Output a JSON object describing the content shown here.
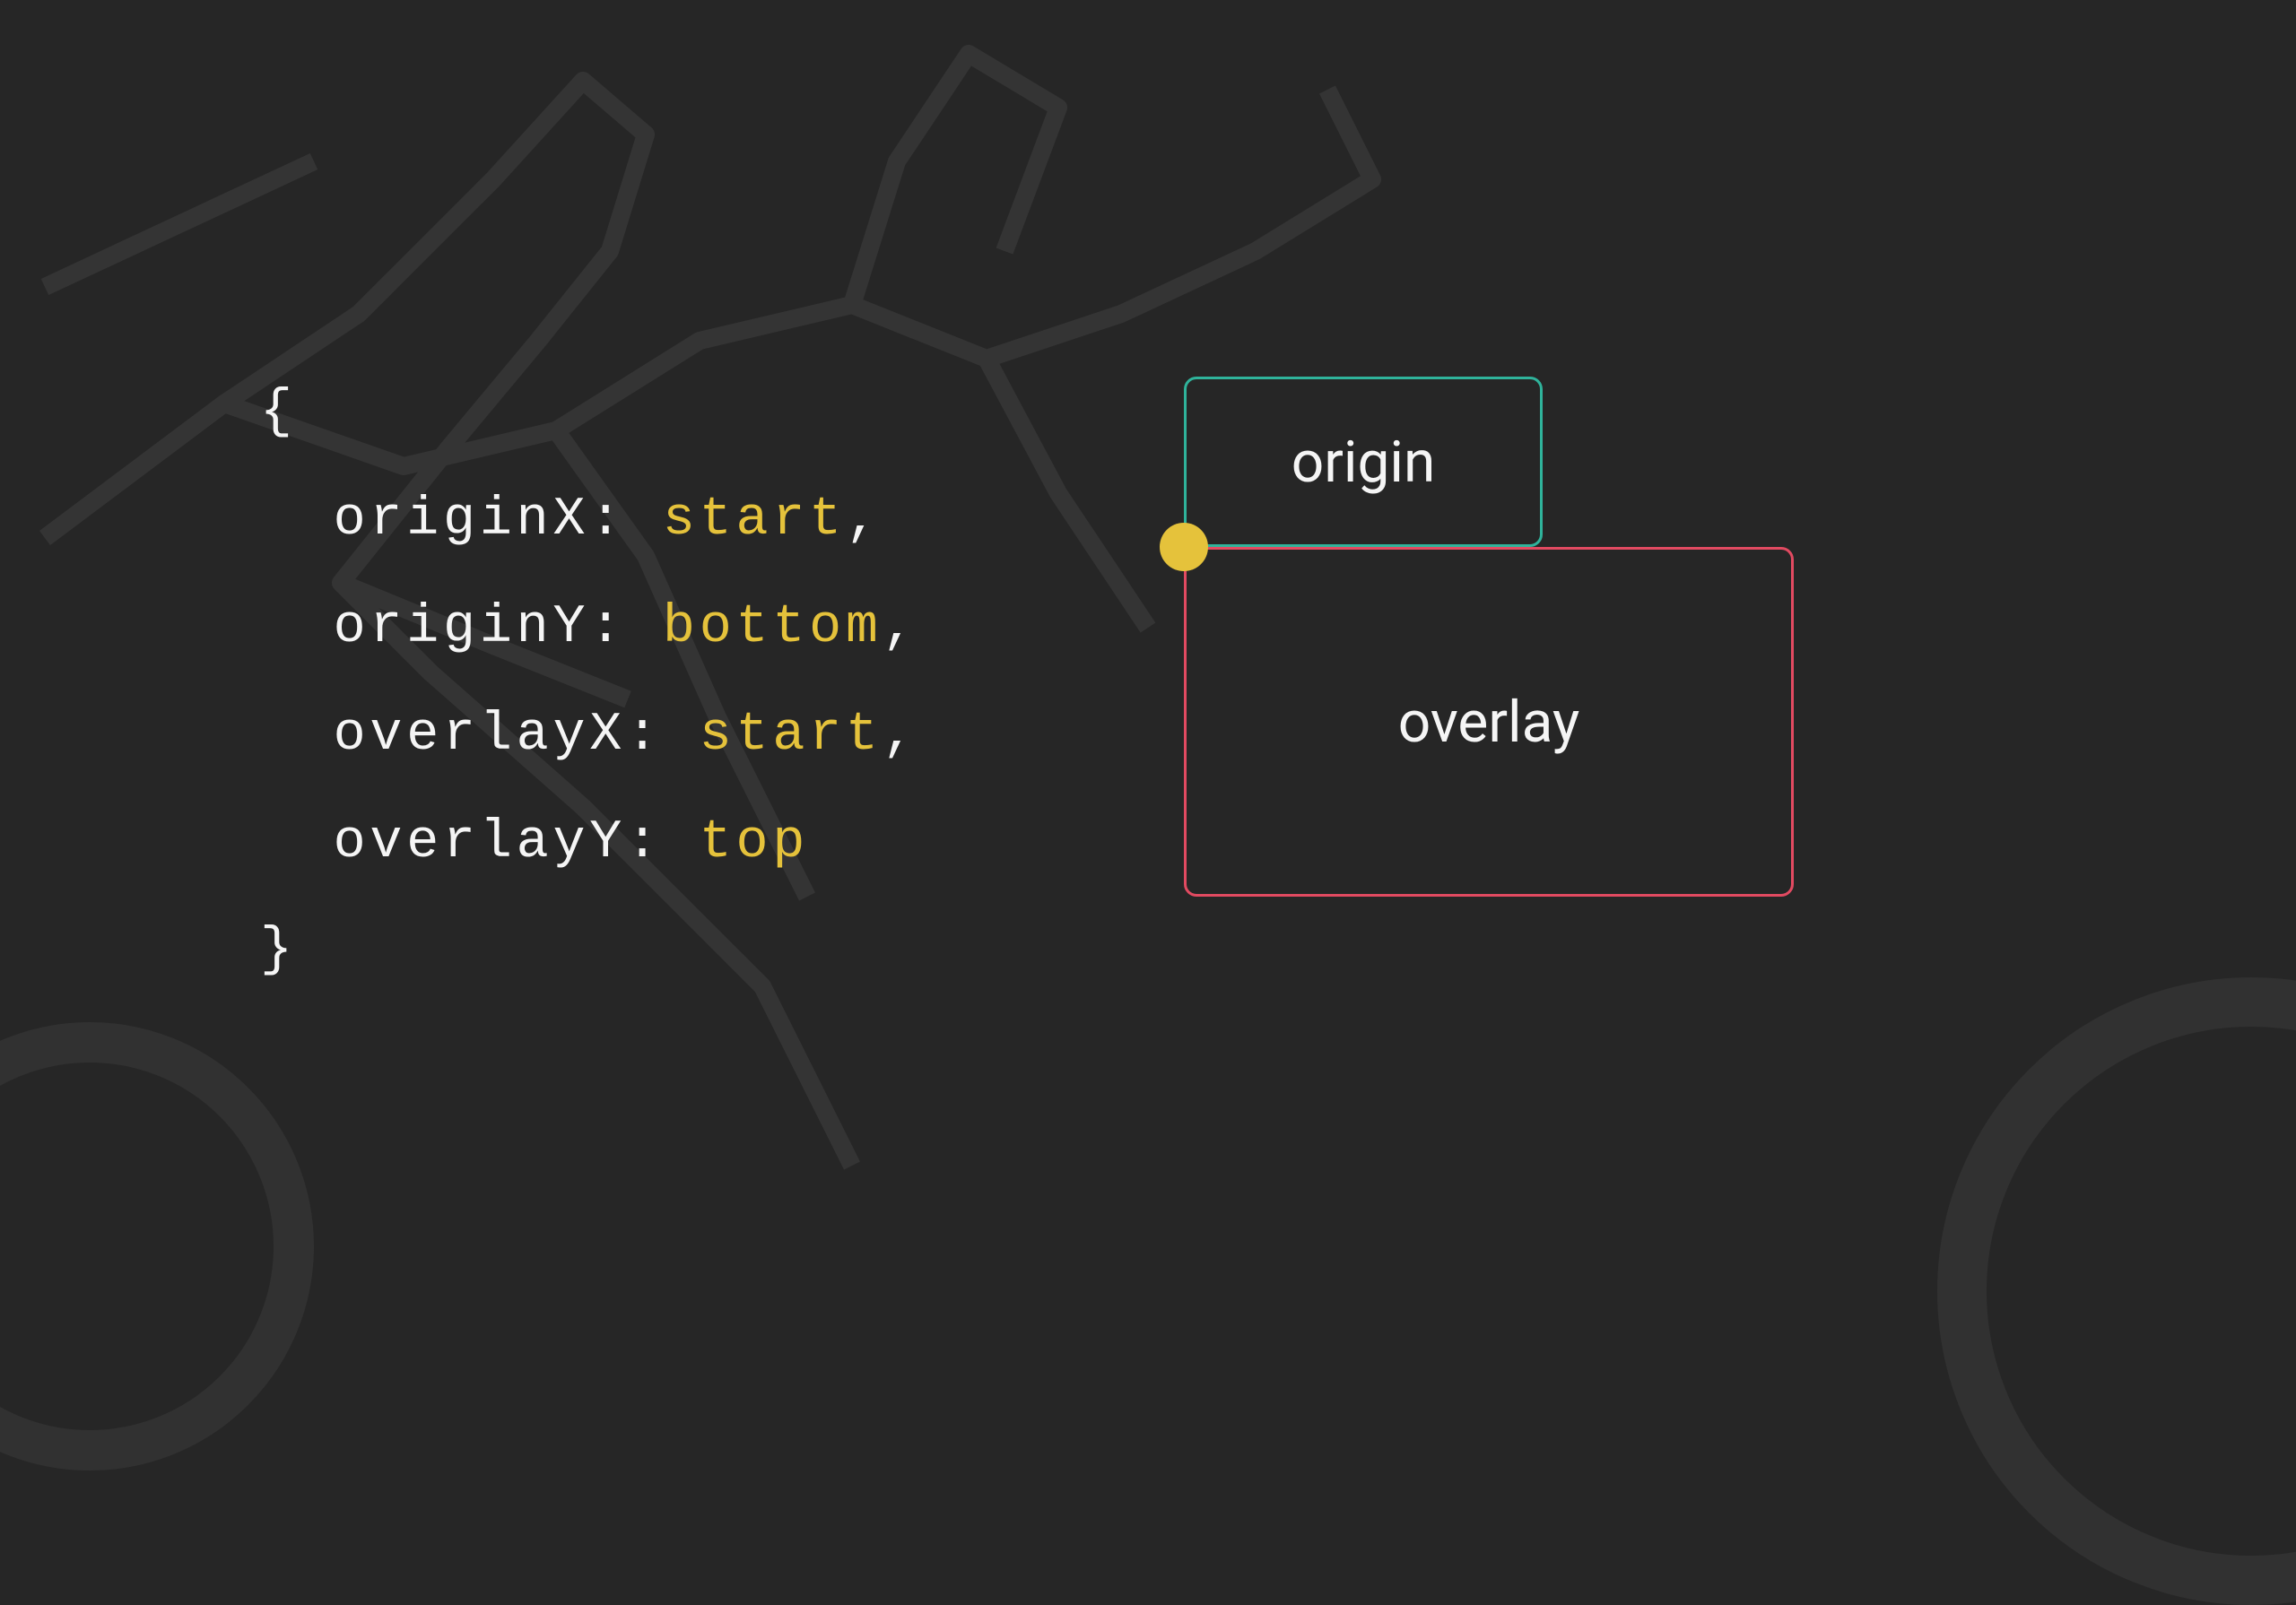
{
  "code": {
    "open_brace": "{",
    "close_brace": "}",
    "lines": [
      {
        "key": "originX",
        "value": "start",
        "trailing_comma": ","
      },
      {
        "key": "originY",
        "value": "bottom",
        "trailing_comma": ","
      },
      {
        "key": "overlayX",
        "value": "start",
        "trailing_comma": ","
      },
      {
        "key": "overlayY",
        "value": "top",
        "trailing_comma": ""
      }
    ]
  },
  "diagram": {
    "origin_label": "origin",
    "overlay_label": "overlay"
  },
  "colors": {
    "background": "#262626",
    "origin_border": "#2fb39b",
    "overlay_border": "#e24a61",
    "accent_yellow": "#e5c23b",
    "text": "#f5f5f5"
  }
}
